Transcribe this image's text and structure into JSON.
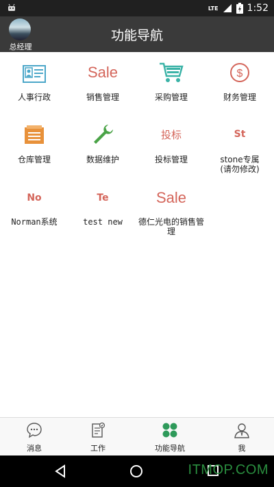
{
  "status_bar": {
    "network": "LTE",
    "time": "1:52"
  },
  "header": {
    "user_name": "总经理",
    "title": "功能导航"
  },
  "modules": [
    {
      "label": "人事行政",
      "icon": "id-card-icon"
    },
    {
      "label": "销售管理",
      "icon": "sale-text-icon",
      "icon_text": "Sale"
    },
    {
      "label": "采购管理",
      "icon": "shopping-cart-icon"
    },
    {
      "label": "财务管理",
      "icon": "dollar-circle-icon"
    },
    {
      "label": "仓库管理",
      "icon": "warehouse-icon"
    },
    {
      "label": "数据维护",
      "icon": "wrench-icon"
    },
    {
      "label": "投标管理",
      "icon": "bid-text-icon",
      "icon_text": "投标"
    },
    {
      "label": "stone专属(请勿修改)",
      "icon": "st-text-icon",
      "icon_text": "St"
    },
    {
      "label": "Norman系统",
      "icon": "no-text-icon",
      "icon_text": "No"
    },
    {
      "label": "test new",
      "icon": "te-text-icon",
      "icon_text": "Te"
    },
    {
      "label": "德仁光电的销售管理",
      "icon": "sale-text-icon",
      "icon_text": "Sale"
    }
  ],
  "bottom_nav": [
    {
      "label": "消息",
      "icon": "chat-bubble-icon"
    },
    {
      "label": "工作",
      "icon": "clipboard-icon"
    },
    {
      "label": "功能导航",
      "icon": "four-dots-icon",
      "active": true
    },
    {
      "label": "我",
      "icon": "person-icon"
    }
  ],
  "watermark": "ITMOP.COM",
  "colors": {
    "accent_green": "#2e9a5a",
    "sale_red": "#d4655a",
    "icon_blue": "#4aa6c8",
    "icon_teal": "#3bb3a7",
    "icon_orange": "#e8913a"
  }
}
